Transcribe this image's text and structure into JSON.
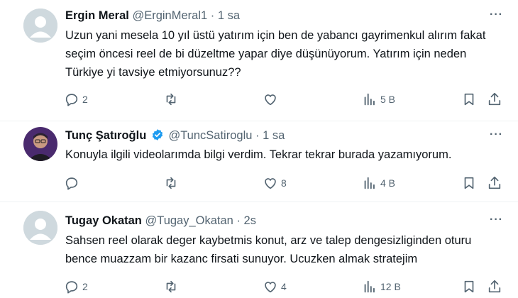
{
  "tweets": [
    {
      "name": "Ergin Meral",
      "handle": "@ErginMeral1",
      "time": "1 sa",
      "text": "Uzun yani mesela 10 yıl üstü yatırım için ben de yabancı gayrimenkul alırım fakat seçim öncesi reel de bi düzeltme yapar diye düşünüyorum. Yatırım için neden Türkiye yi tavsiye etmiyorsunuz??",
      "replies": "2",
      "retweets": "",
      "likes": "",
      "views": "5 B",
      "avatar": "default",
      "verified": false
    },
    {
      "name": "Tunç Şatıroğlu",
      "handle": "@TuncSatiroglu",
      "time": "1 sa",
      "text": "Konuyla ilgili videolarımda bilgi verdim. Tekrar tekrar burada yazamıyorum.",
      "replies": "",
      "retweets": "",
      "likes": "8",
      "views": "4 B",
      "avatar": "photo",
      "verified": true
    },
    {
      "name": "Tugay Okatan",
      "handle": "@Tugay_Okatan",
      "time": "2s",
      "text": "Sahsen reel olarak deger kaybetmis konut, arz ve talep dengesizliginden oturu bence muazzam bir kazanc firsati sunuyor. Ucuzken almak stratejim",
      "replies": "2",
      "retweets": "",
      "likes": "4",
      "views": "12 B",
      "avatar": "default",
      "verified": false
    }
  ],
  "separator": "·",
  "more_label": "···",
  "colors": {
    "text": "#0f1419",
    "muted": "#536471",
    "verified": "#1d9bf0",
    "divider": "#eff3f4"
  },
  "icons": [
    "reply-icon",
    "retweet-icon",
    "like-icon",
    "views-icon",
    "bookmark-icon",
    "share-icon",
    "verified-badge-icon",
    "more-icon"
  ]
}
